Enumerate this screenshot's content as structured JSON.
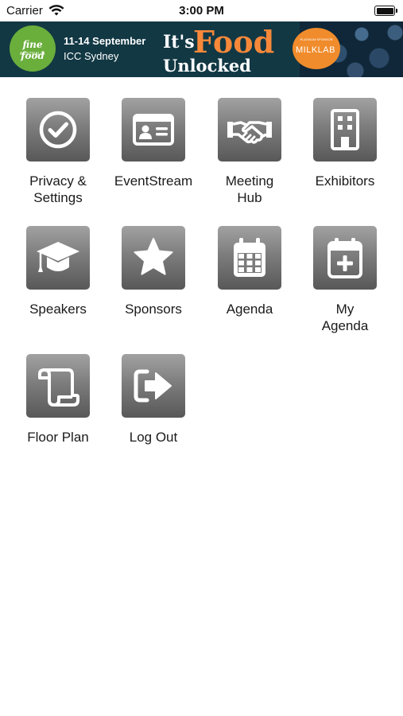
{
  "status_bar": {
    "carrier": "Carrier",
    "time": "3:00 PM"
  },
  "banner": {
    "logo_text": "fine food",
    "logo_subtext": "AUSTRALIA",
    "dates": "11-14 September",
    "venue": "ICC Sydney",
    "tag_its": "It's",
    "tag_food": "Food",
    "tag_unlocked": "Unlocked",
    "sponsor_small": "PLATINUM SPONSOR",
    "sponsor_name": "MILKLAB",
    "accent_color": "#f7883a"
  },
  "menu": [
    {
      "lines": [
        "Privacy &",
        "Settings"
      ],
      "icon": "check-circle-icon"
    },
    {
      "lines": [
        "EventStream"
      ],
      "icon": "id-card-icon"
    },
    {
      "lines": [
        "Meeting",
        "Hub"
      ],
      "icon": "handshake-icon"
    },
    {
      "lines": [
        "Exhibitors"
      ],
      "icon": "building-icon"
    },
    {
      "lines": [
        "Speakers"
      ],
      "icon": "graduation-cap-icon"
    },
    {
      "lines": [
        "Sponsors"
      ],
      "icon": "star-icon"
    },
    {
      "lines": [
        "Agenda"
      ],
      "icon": "calendar-icon"
    },
    {
      "lines": [
        "My",
        "Agenda"
      ],
      "icon": "calendar-plus-icon"
    },
    {
      "lines": [
        "Floor Plan"
      ],
      "icon": "scroll-icon"
    },
    {
      "lines": [
        "Log Out"
      ],
      "icon": "sign-out-icon"
    }
  ]
}
